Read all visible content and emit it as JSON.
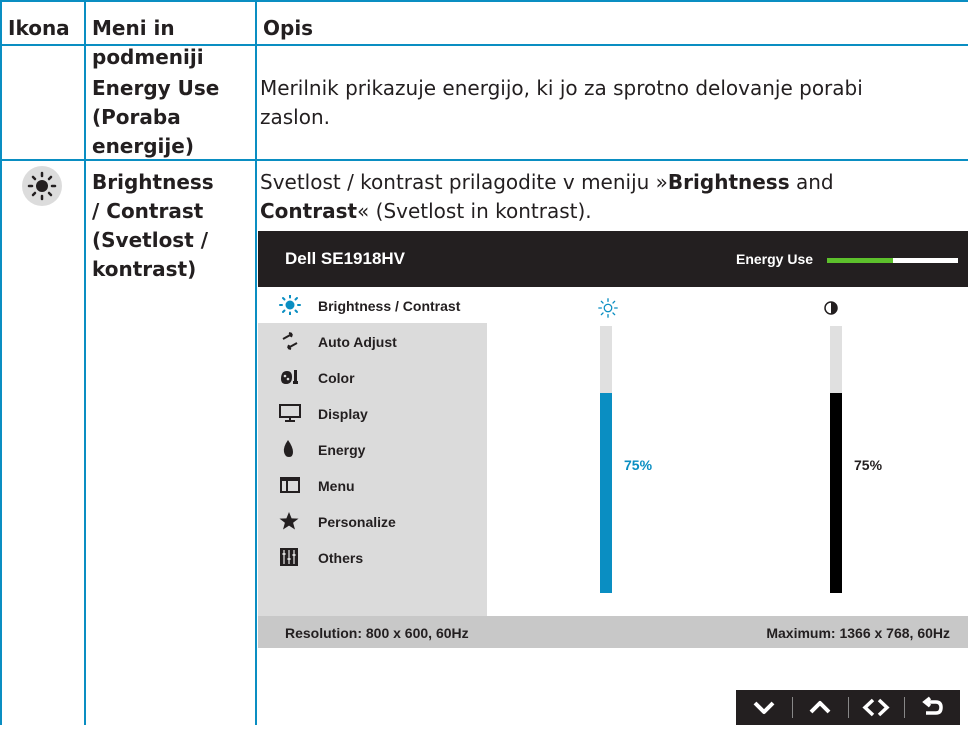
{
  "table": {
    "headers": [
      "Ikona",
      "Meni in podmeniji",
      "Opis"
    ],
    "header_line1": "Meni in",
    "header_line2": "podmeniji",
    "rows": [
      {
        "menu_lines": [
          "Energy Use",
          "(Poraba",
          "energije)"
        ],
        "desc_line1": "Merilnik prikazuje energijo, ki jo za sprotno delovanje porabi",
        "desc_line2": "zaslon."
      },
      {
        "icon": "brightness-icon",
        "menu_lines": [
          "Brightness",
          "/ Contrast",
          "(Svetlost /",
          "kontrast)"
        ],
        "desc_l1_a": "Svetlost / kontrast prilagodite v meniju »",
        "desc_l1_b": "Brightness",
        "desc_l1_c": " and",
        "desc_l2_a": "Contrast",
        "desc_l2_b": "« (Svetlost in kontrast)."
      }
    ]
  },
  "osd": {
    "model": "Dell SE1918HV",
    "energy_label": "Energy Use",
    "energy_level": 0.5,
    "menu_items": [
      {
        "label": "Brightness / Contrast",
        "icon": "brightness-icon",
        "selected": true
      },
      {
        "label": "Auto Adjust",
        "icon": "auto-adjust-icon"
      },
      {
        "label": "Color",
        "icon": "color-icon"
      },
      {
        "label": "Display",
        "icon": "display-icon"
      },
      {
        "label": "Energy",
        "icon": "energy-icon"
      },
      {
        "label": "Menu",
        "icon": "menu-icon"
      },
      {
        "label": "Personalize",
        "icon": "star-icon"
      },
      {
        "label": "Others",
        "icon": "others-icon"
      }
    ],
    "brightness": {
      "value": 75,
      "label": "75%",
      "color": "#0a8ec2"
    },
    "contrast": {
      "value": 75,
      "label": "75%",
      "color": "#000000"
    },
    "resolution": "Resolution: 800 x 600, 60Hz",
    "maximum": "Maximum: 1366 x 768, 60Hz"
  },
  "nav_buttons": [
    "down-arrow-icon",
    "up-arrow-icon",
    "left-right-arrows-icon",
    "back-icon"
  ],
  "colors": {
    "border": "#0a8ec2",
    "energy_green": "#5dc02c",
    "osd_dark": "#231f20"
  }
}
